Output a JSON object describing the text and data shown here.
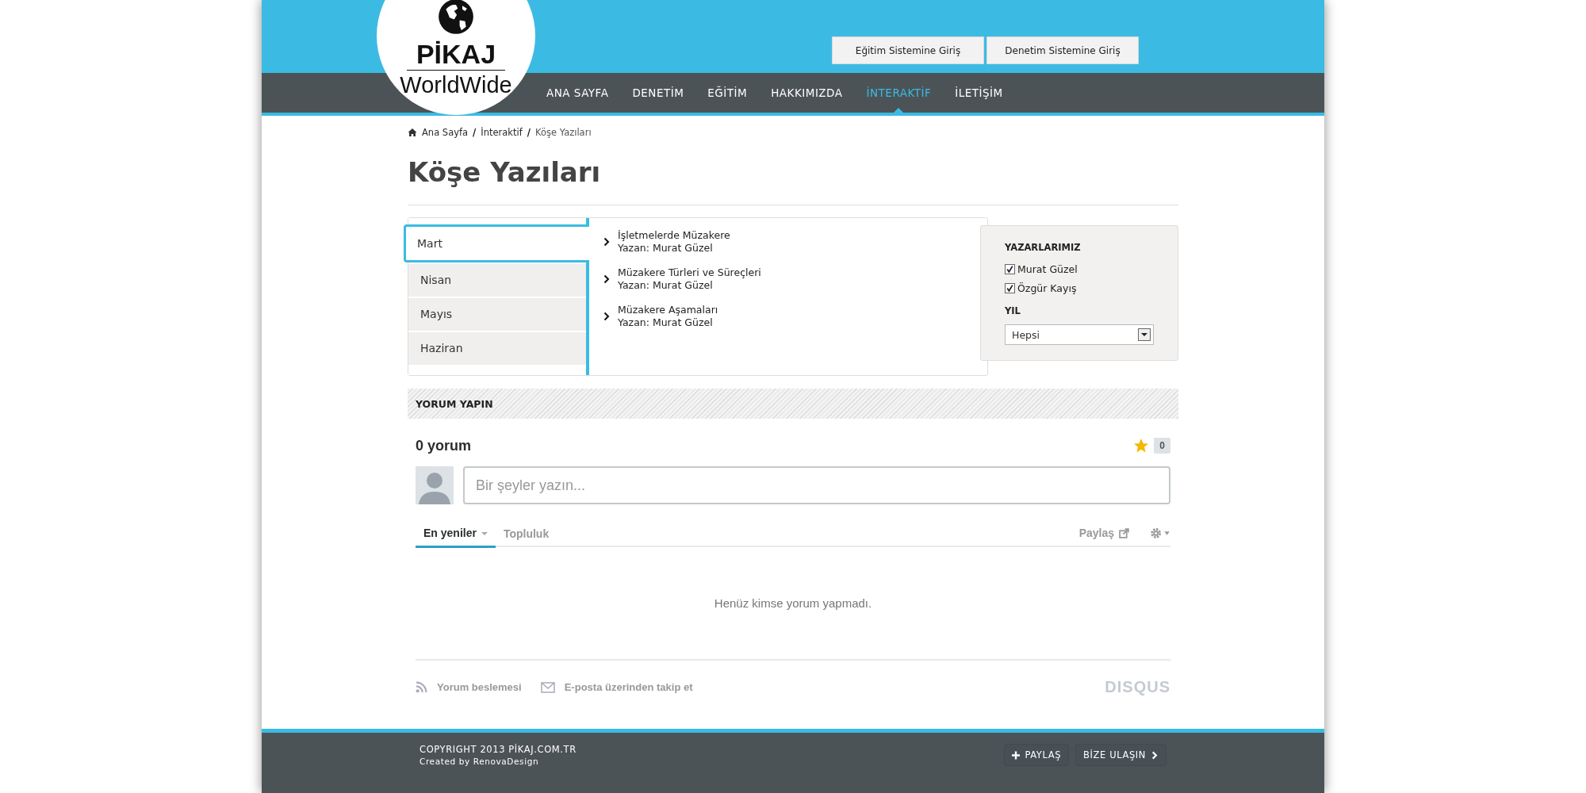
{
  "logo": {
    "title": "PİKAJ",
    "subtitle": "WorldWide"
  },
  "top_buttons": [
    "Eğitim Sistemine Giriş",
    "Denetim Sistemine Giriş"
  ],
  "nav": [
    {
      "label": "ANA SAYFA",
      "selected": false
    },
    {
      "label": "DENETİM",
      "selected": false
    },
    {
      "label": "EĞİTİM",
      "selected": false
    },
    {
      "label": "HAKKIMIZDA",
      "selected": false
    },
    {
      "label": "İNTERAKTİF",
      "selected": true
    },
    {
      "label": "İLETİŞİM",
      "selected": false
    }
  ],
  "breadcrumb": [
    {
      "kind": "link",
      "text": "Ana Sayfa"
    },
    {
      "kind": "separator",
      "text": "/"
    },
    {
      "kind": "link",
      "text": "İnteraktif"
    },
    {
      "kind": "separator",
      "text": "/"
    },
    {
      "kind": "current",
      "text": "Köşe Yazıları"
    }
  ],
  "page_title": "Köşe Yazıları",
  "months": [
    {
      "label": "Mart",
      "selected": true
    },
    {
      "label": "Nisan",
      "selected": false
    },
    {
      "label": "Mayıs",
      "selected": false
    },
    {
      "label": "Haziran",
      "selected": false
    }
  ],
  "articles": [
    {
      "title": "İşletmelerde Müzakere",
      "author": "Yazan: Murat Güzel"
    },
    {
      "title": "Müzakere Türleri ve Süreçleri",
      "author": "Yazan: Murat Güzel"
    },
    {
      "title": "Müzakere Aşamaları",
      "author": "Yazan: Murat Güzel"
    }
  ],
  "filter": {
    "authors_heading": "YAZARLARIMIZ",
    "authors": [
      {
        "name": "Murat Güzel",
        "checked": true
      },
      {
        "name": "Özgür Kayış",
        "checked": true
      }
    ],
    "year_heading": "YIL",
    "year_value": "Hepsi"
  },
  "comments": {
    "heading": "YORUM YAPIN",
    "count": "0 yorum",
    "favorites": "0",
    "placeholder": "Bir şeyler yazın...",
    "tabs": [
      {
        "label": "En yeniler",
        "selected": true
      },
      {
        "label": "Topluluk",
        "selected": false
      }
    ],
    "share": "Paylaş",
    "empty": "Henüz kimse yorum yapmadı.",
    "feed": "Yorum beslemesi",
    "email": "E-posta üzerinden takip et",
    "brand": "DISQUS"
  },
  "footer": {
    "copyright": "COPYRIGHT 2013 PİKAJ.COM.TR",
    "credit": "Created by RenovaDesign",
    "buttons": [
      "PAYLAŞ",
      "BİZE ULAŞIN"
    ]
  }
}
